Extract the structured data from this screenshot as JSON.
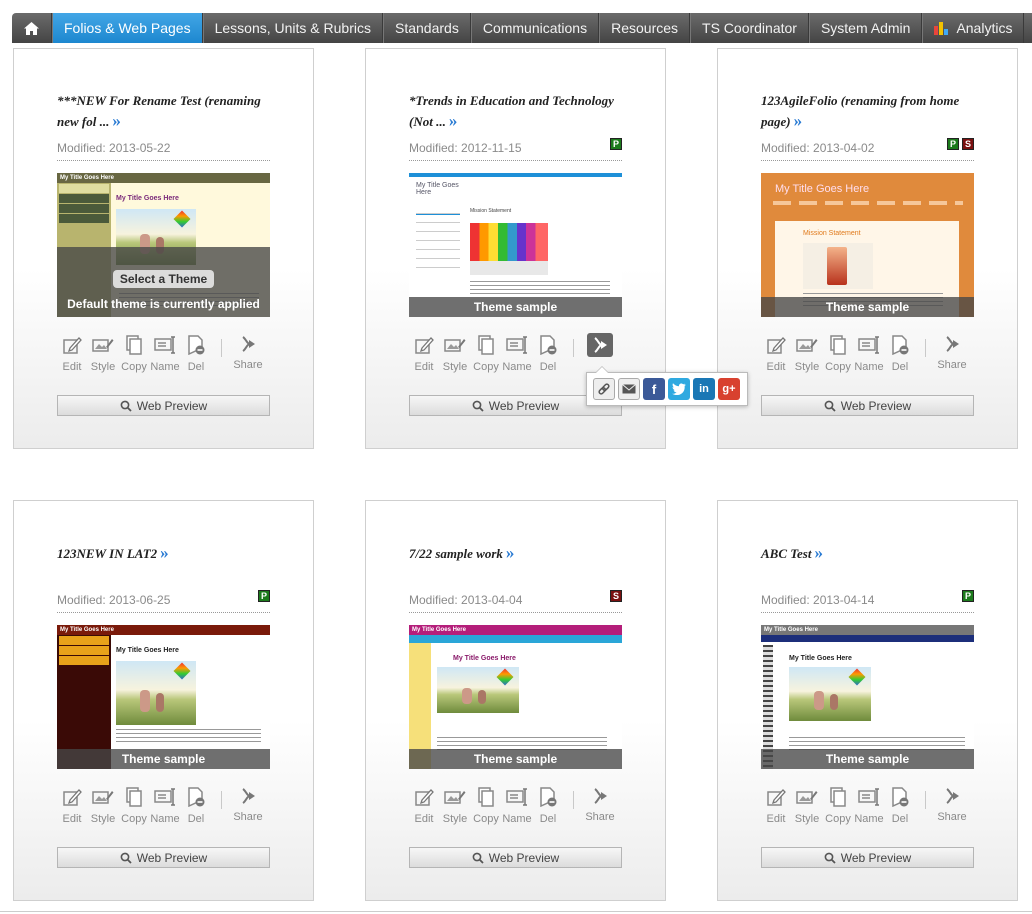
{
  "nav": {
    "items": [
      {
        "label": "Folios & Web Pages",
        "active": true
      },
      {
        "label": "Lessons, Units & Rubrics"
      },
      {
        "label": "Standards"
      },
      {
        "label": "Communications"
      },
      {
        "label": "Resources"
      },
      {
        "label": "TS Coordinator"
      },
      {
        "label": "System Admin"
      },
      {
        "label": "Analytics"
      }
    ]
  },
  "actions": {
    "edit": "Edit",
    "style": "Style",
    "copy": "Copy",
    "name": "Name",
    "del": "Del",
    "share": "Share"
  },
  "preview_label": "Web Preview",
  "thumb_texts": {
    "my_title": "My Title Goes Here",
    "mission": "Mission Statement"
  },
  "cards": [
    {
      "title": "***NEW For Rename Test (renaming new fol ...",
      "modified": "Modified: 2013-05-22",
      "badges": [],
      "overlay": "Default theme is currently applied",
      "select_theme": "Select a Theme"
    },
    {
      "title": "*Trends in Education and Technology (Not ...",
      "modified": "Modified: 2012-11-15",
      "badges": [
        "P"
      ],
      "overlay": "Theme sample"
    },
    {
      "title": "123AgileFolio (renaming from home page)",
      "modified": "Modified: 2013-04-02",
      "badges": [
        "P",
        "S"
      ],
      "overlay": "Theme sample"
    },
    {
      "title": "123NEW IN LAT2",
      "modified": "Modified: 2013-06-25",
      "badges": [
        "P"
      ],
      "overlay": "Theme sample"
    },
    {
      "title": "7/22 sample work",
      "modified": "Modified: 2013-04-04",
      "badges": [
        "S"
      ],
      "overlay": "Theme sample"
    },
    {
      "title": "ABC Test",
      "modified": "Modified: 2013-04-14",
      "badges": [
        "P"
      ],
      "overlay": "Theme sample"
    }
  ],
  "share_popup": {
    "buttons": [
      "link-icon",
      "email-icon",
      "facebook-icon",
      "twitter-icon",
      "linkedin-icon",
      "googleplus-icon"
    ]
  },
  "colors": {
    "nav_active": "#1d87cf",
    "badge_p": "#1c7a1c",
    "badge_s": "#7a1010",
    "link_arrow": "#2a7bd3"
  }
}
